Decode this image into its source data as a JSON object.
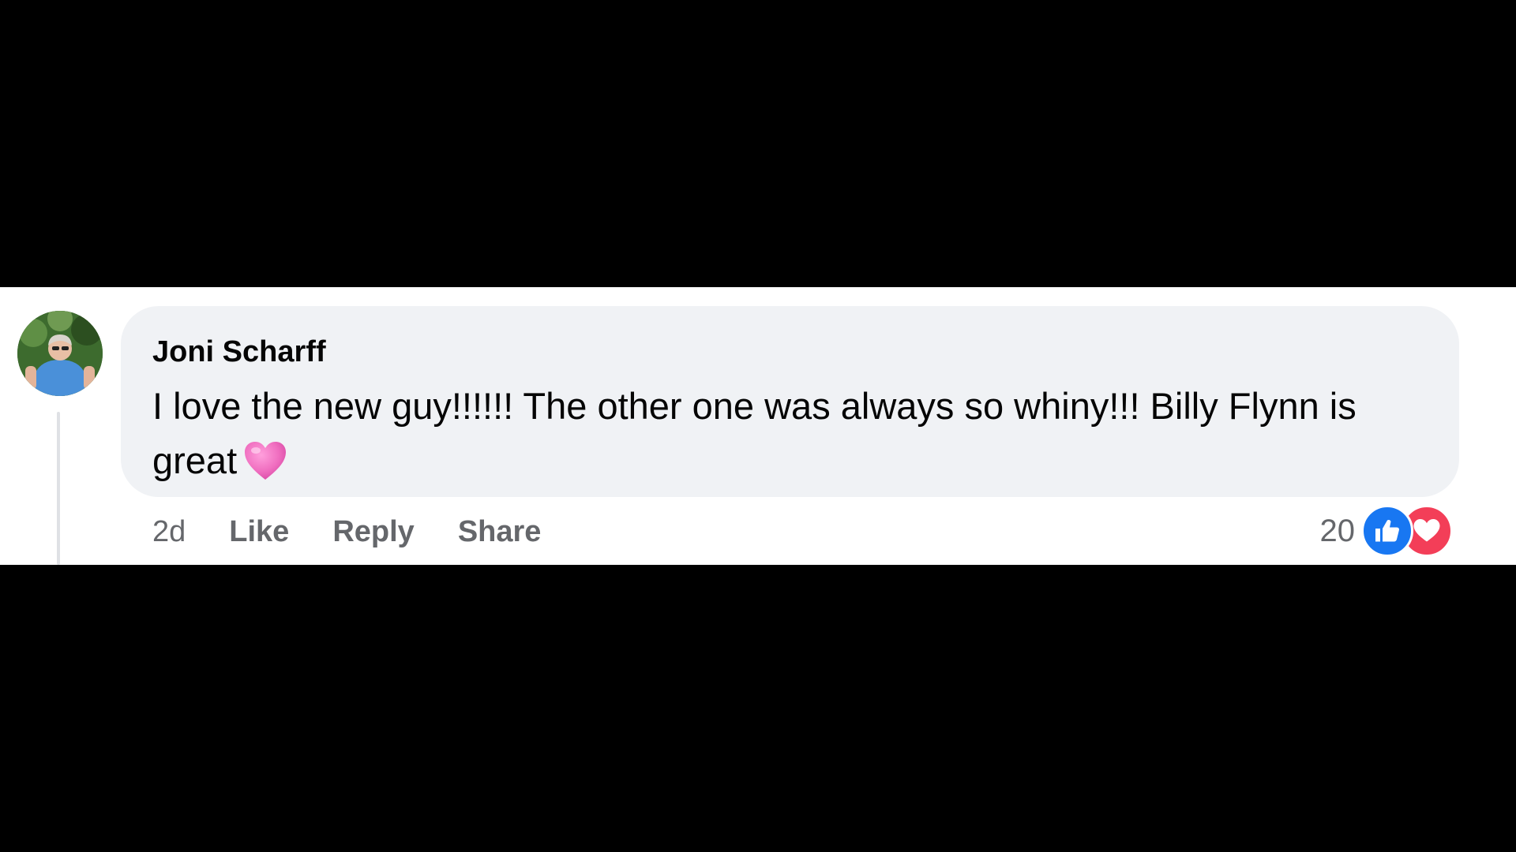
{
  "comment": {
    "author": "Joni Scharff",
    "text": "I love the new guy!!!!!! The other one was always so whiny!!! Billy Flynn is great",
    "emoji": "pink-heart",
    "timestamp": "2d",
    "actions": {
      "like_label": "Like",
      "reply_label": "Reply",
      "share_label": "Share"
    },
    "reactions": {
      "count": "20",
      "types": [
        "like-icon",
        "love-icon"
      ]
    }
  },
  "colors": {
    "bubble_bg": "#f0f2f5",
    "like_blue": "#1877f2",
    "love_red": "#f33e58",
    "muted_text": "#65676b",
    "heart_pink": "#f06fc0"
  }
}
